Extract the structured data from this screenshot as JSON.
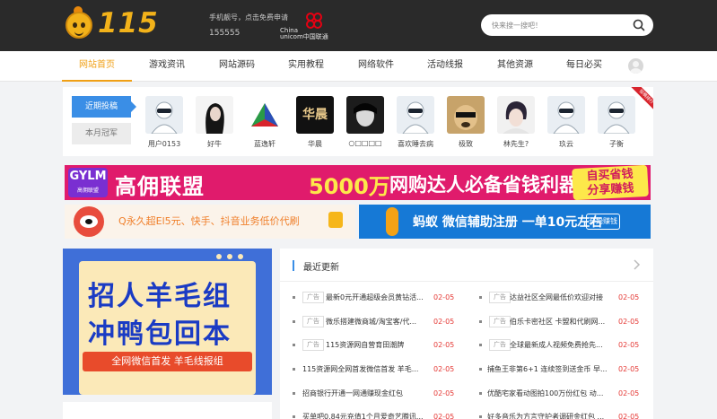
{
  "header": {
    "logo_text": "115",
    "promo_line1": "手机靓号，点击免费申请",
    "promo_line2": "155555",
    "unicom_text_en": "China",
    "unicom_text_cn": "unicom中国联通",
    "search_placeholder": "快来搜一搜吧！"
  },
  "nav": {
    "items": [
      {
        "label": "网站首页",
        "active": true
      },
      {
        "label": "游戏资讯"
      },
      {
        "label": "网站源码"
      },
      {
        "label": "实用教程"
      },
      {
        "label": "网络软件"
      },
      {
        "label": "活动线报"
      },
      {
        "label": "其他资源"
      },
      {
        "label": "每日必买"
      }
    ]
  },
  "members": {
    "tab_recent": "近期投稿",
    "tab_month": "本月冠军",
    "ribbon": "投稿排行",
    "list": [
      {
        "name": "用户0153"
      },
      {
        "name": "好牛"
      },
      {
        "name": "蓝逸轩"
      },
      {
        "name": "华晨",
        "avatar_text": "华晨"
      },
      {
        "name": "○□□□□"
      },
      {
        "name": "喜欢睡去病"
      },
      {
        "name": "极致"
      },
      {
        "name": "林先生?"
      },
      {
        "name": "玖云"
      },
      {
        "name": "子衡"
      }
    ]
  },
  "banner_gylm": {
    "logo_mark": "GYLM",
    "logo_sub": "高佣联盟",
    "title": "高佣联盟",
    "amount": "5000万",
    "slogan": "网购达人必备省钱利器",
    "tag_line1": "自买省钱",
    "tag_line2": "分享赚钱"
  },
  "banner_qq": {
    "text": "Q永久超El5元、快手、抖音业务低价代刷"
  },
  "banner_ant": {
    "text": "蚂蚁 微信辅助注册 一单10元左右",
    "button": "开始赚钱"
  },
  "poster": {
    "line1": "招人羊毛组",
    "line2": "冲鸭包回本",
    "bar": "全网微信首发 羊毛线报组"
  },
  "latest": {
    "title": "最近更新",
    "tag_label": "广告",
    "left": [
      {
        "ad": true,
        "title": "最新0元开通超级会员黄钻活...",
        "date": "02-05"
      },
      {
        "ad": true,
        "title": "微乐搭建微商城/淘宝客/代...",
        "date": "02-05"
      },
      {
        "ad": true,
        "title": "115资源网自营育田潮牌",
        "date": "02-05"
      },
      {
        "ad": false,
        "title": "115资源网全网首发微信首发 羊毛...",
        "date": "02-05"
      },
      {
        "ad": false,
        "title": "招商银行开通一网通赚现金红包",
        "date": "02-05"
      },
      {
        "ad": false,
        "title": "买单吧0.84元充值1个月爱奇艺腾讯...",
        "date": "02-05"
      }
    ],
    "right": [
      {
        "ad": true,
        "title": "达益社区全网最低价欢迎对接",
        "date": "02-05"
      },
      {
        "ad": true,
        "title": "伯乐卡密社区 卡盟和代刷网...",
        "date": "02-05"
      },
      {
        "ad": true,
        "title": "全球最新成人视频免费抢先...",
        "date": "02-05"
      },
      {
        "ad": false,
        "title": "捕鱼王非第6+1 连续签到送金币 早...",
        "date": "02-05"
      },
      {
        "ad": false,
        "title": "优酷宅家看动图拍100万份红包 动...",
        "date": "02-05"
      },
      {
        "ad": false,
        "title": "好多音乐为方言守护者调研金红包 ...",
        "date": "02-05"
      }
    ]
  }
}
